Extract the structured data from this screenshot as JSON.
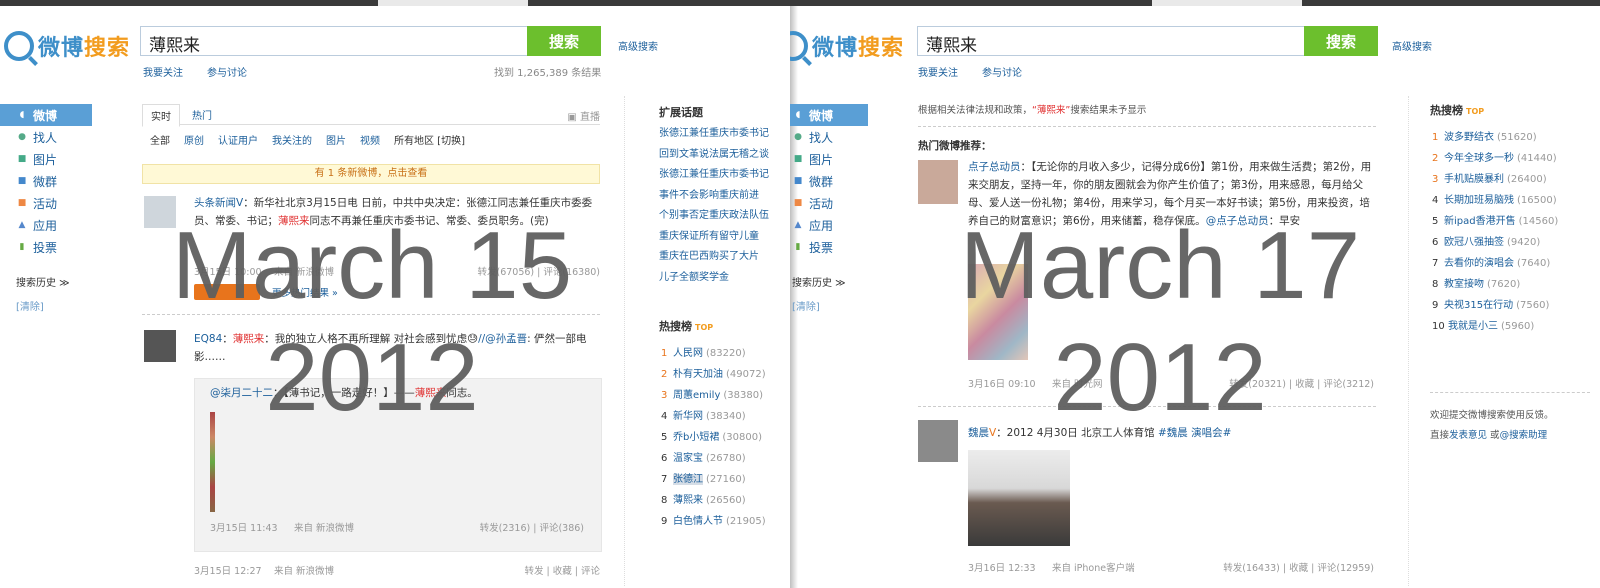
{
  "left": {
    "logo": {
      "text": "微博",
      "highlight": "搜索"
    },
    "search": {
      "query": "薄熙来",
      "button": "搜索",
      "advanced": "高级搜索"
    },
    "sublinks": [
      "我要关注",
      "参与讨论"
    ],
    "found": "找到 1,265,389 条结果",
    "sidebar": {
      "items": [
        "微博",
        "找人",
        "图片",
        "微群",
        "活动",
        "应用",
        "投票"
      ],
      "history": "搜索历史 ≫",
      "clear": "[清除]"
    },
    "tabs": {
      "realtime": "实时",
      "hot": "热门",
      "live": "直播"
    },
    "filters": [
      "全部",
      "原创",
      "认证用户",
      "我关注的",
      "图片",
      "视频",
      "所有地区 [切换]"
    ],
    "new_notice": "有 1 条新微博，点击查看",
    "post1": {
      "user": "头条新闻",
      "text_a": "：新华社北京3月15日电 日前，中共中央决定：张德江同志兼任重庆市委委员、常委、书记；",
      "kw": "薄熙来",
      "text_b": "同志不再兼任重庆市委书记、常委、委员职务。(完)",
      "time": "3月15日 10:00",
      "source": "来自 新浪微博",
      "stats": "转发(67056) | 评论(16380)",
      "more": "更多热门结果 »"
    },
    "post2": {
      "user": "EQ84",
      "kw": "薄熙来",
      "text_a": "：我的独立人格不再所理解 对社会感到忧虑",
      "mention": "//@孙孟晋",
      "text_b": ": 俨然一部电影……",
      "repost_user": "@柒月二十二",
      "repost_a": "：【薄书记，一路走好！】——",
      "repost_kw": "薄熙来",
      "repost_b": "同志。",
      "repost_time": "3月15日 11:43",
      "repost_source": "来自 新浪微博",
      "repost_stats": "转发(2316) | 评论(386)",
      "time": "3月15日 12:27",
      "source": "来自 新浪微博",
      "stats": "转发 | 收藏 | 评论"
    },
    "extended": {
      "title": "扩展话题",
      "items": [
        "张德江兼任重庆市委书记",
        "回到文革说法属无稽之谈",
        "张德江兼任重庆市委书记",
        "事件不会影响重庆前进",
        "个别事否定重庆政法队伍",
        "重庆保证所有留守儿童",
        "重庆在巴西购买了大片",
        "儿子全额奖学金"
      ]
    },
    "hot": {
      "title": "热搜榜",
      "badge": "TOP",
      "items": [
        {
          "n": "1",
          "k": "人民网",
          "c": "(83220)"
        },
        {
          "n": "2",
          "k": "朴有天加油",
          "c": "(49072)"
        },
        {
          "n": "3",
          "k": "周蕙emily",
          "c": "(38380)"
        },
        {
          "n": "4",
          "k": "新华网",
          "c": "(38340)"
        },
        {
          "n": "5",
          "k": "乔b小短裙",
          "c": "(30800)"
        },
        {
          "n": "6",
          "k": "温家宝",
          "c": "(26780)"
        },
        {
          "n": "7",
          "k": "张德江",
          "c": "(27160)"
        },
        {
          "n": "8",
          "k": "薄熙来",
          "c": "(26560)"
        },
        {
          "n": "9",
          "k": "白色情人节",
          "c": "(21905)"
        }
      ]
    },
    "overlay": {
      "line1": "March 15",
      "line2": "2012"
    }
  },
  "right": {
    "logo": {
      "text": "微博",
      "highlight": "搜索"
    },
    "search": {
      "query": "薄熙来",
      "button": "搜索",
      "advanced": "高级搜索"
    },
    "sublinks": [
      "我要关注",
      "参与讨论"
    ],
    "sidebar": {
      "items": [
        "微博",
        "找人",
        "图片",
        "微群",
        "活动",
        "应用",
        "投票"
      ],
      "history": "搜索历史 ≫",
      "clear": "[清除]"
    },
    "notice": {
      "a": "根据相关法律法规和政策，",
      "kw": "“薄熙来”",
      "b": "搜索结果未予显示"
    },
    "hot_rec": "热门微博推荐：",
    "post1": {
      "user": "点子总动员",
      "text": "：【无论你的月收入多少，记得分成6份】第1份，用来做生活费；第2份，用来交朋友，坚持一年，你的朋友圈就会为你产生价值了；第3份，用来感恩，每月给父母、爱人送一份礼物；第4份，用来学习，每个月买一本好书读；第5份，用来投资，培养自己的财富意识；第6份，用来储蓄，稳存保底。",
      "mention": "@点子总动员",
      "tail": "：早安",
      "time": "3月16日 09:10",
      "source": "来自 时光网",
      "stats": "转发(20321) | 收藏 | 评论(3212)"
    },
    "post2": {
      "user": "魏晨",
      "text": "：2012 4月30日 北京工人体育馆 ",
      "tag": "#魏晨 演唱会#",
      "time": "3月16日 12:33",
      "source": "来自 iPhone客户端",
      "stats": "转发(16433) | 收藏 | 评论(12959)"
    },
    "hot": {
      "title": "热搜榜",
      "badge": "TOP",
      "items": [
        {
          "n": "1",
          "k": "波多野结衣",
          "c": "(51620)"
        },
        {
          "n": "2",
          "k": "今年全球多一秒",
          "c": "(41440)"
        },
        {
          "n": "3",
          "k": "手机贴膜暴利",
          "c": "(26400)"
        },
        {
          "n": "4",
          "k": "长期加班易脑残",
          "c": "(16500)"
        },
        {
          "n": "5",
          "k": "新ipad香港开售",
          "c": "(14560)"
        },
        {
          "n": "6",
          "k": "欧冠八强抽签",
          "c": "(9420)"
        },
        {
          "n": "7",
          "k": "去看你的演唱会",
          "c": "(7640)"
        },
        {
          "n": "8",
          "k": "教室接吻",
          "c": "(7620)"
        },
        {
          "n": "9",
          "k": "央视315在行动",
          "c": "(7560)"
        },
        {
          "n": "10",
          "k": "我就是小三",
          "c": "(5960)"
        }
      ]
    },
    "feedback": {
      "a": "欢迎提交微博搜索使用反馈。",
      "b": "直接",
      "link1": "发表意见",
      "c": " 或",
      "link2": "@搜索助理"
    },
    "overlay": {
      "line1": "March 17",
      "line2": "2012"
    }
  }
}
